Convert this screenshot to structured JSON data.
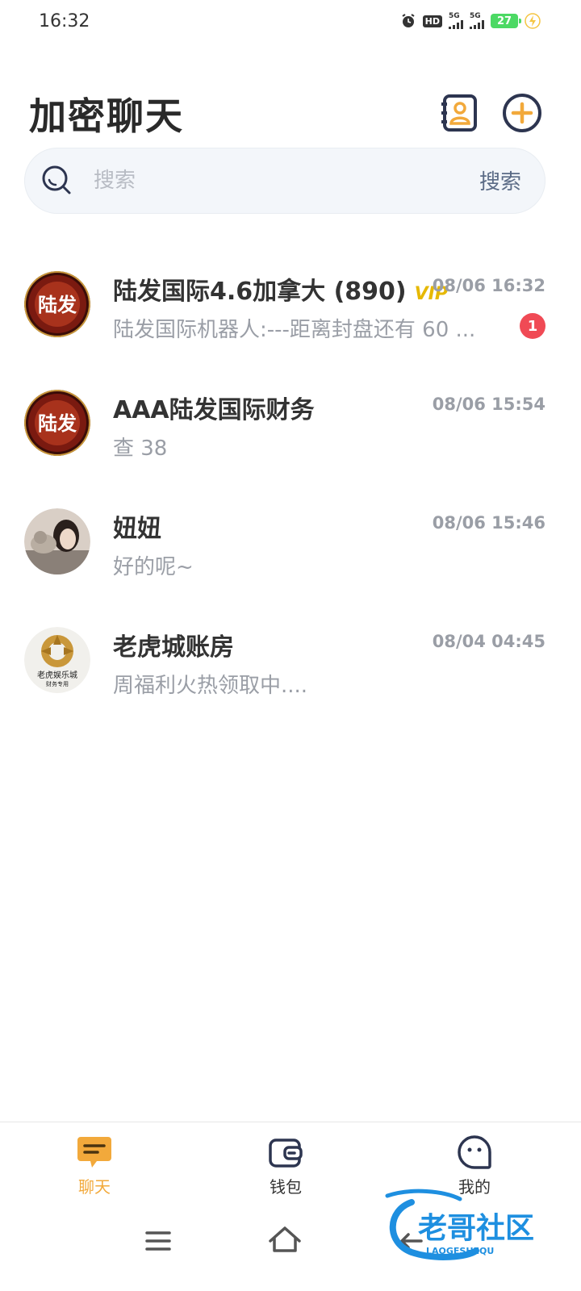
{
  "status_bar": {
    "time": "16:32",
    "hd_label": "HD",
    "signal_1": "5G",
    "signal_2": "5G",
    "battery": "27"
  },
  "header": {
    "title": "加密聊天",
    "contacts_icon": "contacts-book-icon",
    "add_icon": "plus-circle-icon"
  },
  "search": {
    "placeholder": "搜索",
    "button_label": "搜索"
  },
  "chats": [
    {
      "name": "陆发国际4.6加拿大 (890)",
      "vip_label": "VIP",
      "time": "08/06 16:32",
      "preview": "陆发国际机器人:---距离封盘还有 60 ...",
      "unread": "1",
      "avatar_text": "陆发"
    },
    {
      "name": "AAA陆发国际财务",
      "time": "08/06 15:54",
      "preview": "查 38",
      "avatar_text": "陆发"
    },
    {
      "name": "妞妞",
      "time": "08/06 15:46",
      "preview": "好的呢~"
    },
    {
      "name": "老虎城账房",
      "time": "08/04 04:45",
      "preview": "周福利火热领取中....",
      "avatar_text": "老虎娱乐城",
      "avatar_subtext": "财务专用"
    }
  ],
  "bottom_nav": {
    "items": [
      {
        "label": "聊天",
        "icon": "chat-bubble-icon",
        "active": true
      },
      {
        "label": "钱包",
        "icon": "wallet-icon",
        "active": false
      },
      {
        "label": "我的",
        "icon": "profile-face-icon",
        "active": false
      }
    ]
  },
  "colors": {
    "accent": "#f2a93b",
    "badge": "#f04a55",
    "vip": "#e6b800",
    "navy": "#2d3550"
  },
  "watermark": {
    "text": "老哥社区",
    "subtext": "LAOGESHEQU"
  }
}
